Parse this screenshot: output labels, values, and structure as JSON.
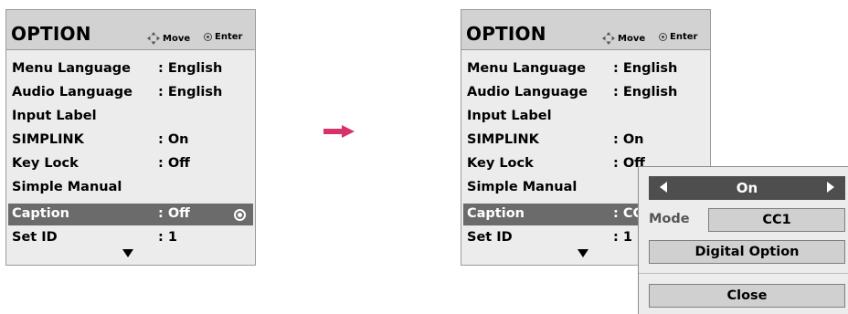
{
  "left_panel": {
    "title": "OPTION",
    "hint_move": "Move",
    "hint_enter": "Enter",
    "items": [
      {
        "label": "Menu Language",
        "value": ": English"
      },
      {
        "label": "Audio Language",
        "value": ": English"
      },
      {
        "label": "Input Label",
        "value": ""
      },
      {
        "label": "SIMPLINK",
        "value": ": On"
      },
      {
        "label": "Key Lock",
        "value": ": Off"
      },
      {
        "label": "Simple Manual",
        "value": ""
      },
      {
        "label": "Caption",
        "value": ": Off"
      },
      {
        "label": "Set ID",
        "value": ": 1"
      }
    ]
  },
  "right_panel": {
    "title": "OPTION",
    "hint_move": "Move",
    "hint_enter": "Enter",
    "items": [
      {
        "label": "Menu Language",
        "value": ": English"
      },
      {
        "label": "Audio Language",
        "value": ": English"
      },
      {
        "label": "Input Label",
        "value": ""
      },
      {
        "label": "SIMPLINK",
        "value": ": On"
      },
      {
        "label": "Key Lock",
        "value": ": Off"
      },
      {
        "label": "Simple Manual",
        "value": ""
      },
      {
        "label": "Caption",
        "value": ": CC"
      },
      {
        "label": "Set ID",
        "value": ": 1"
      }
    ]
  },
  "popup": {
    "selector_value": "On",
    "mode_label": "Mode",
    "mode_value": "CC1",
    "digital_option": "Digital Option",
    "close": "Close"
  },
  "colors": {
    "selected_row": "#6b6b6b",
    "arrow": "#d6336c",
    "panel_bg": "#ececec",
    "header_bg": "#d2d2d2"
  }
}
